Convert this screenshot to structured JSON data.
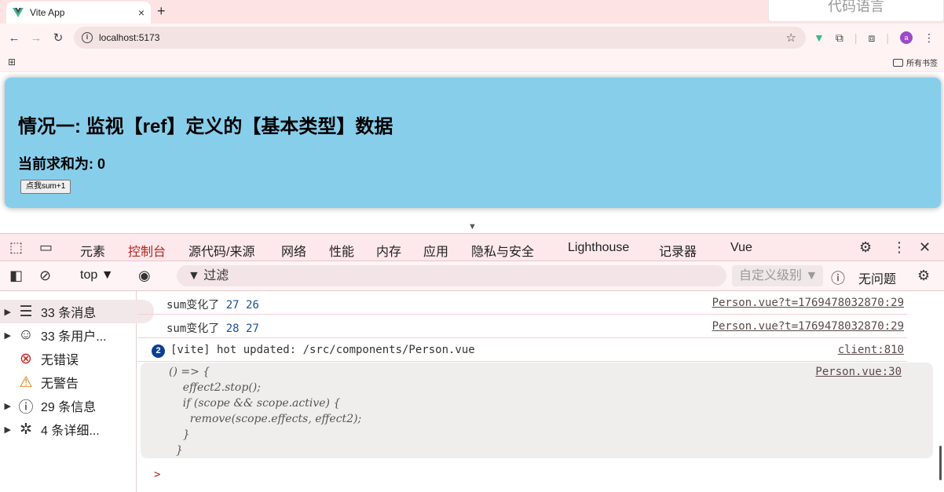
{
  "browser": {
    "tab_title": "Vite App",
    "tab_close": "×",
    "new_tab": "+",
    "overlay_text": "代码语言",
    "url": "localhost:5173",
    "bookmarks_all": "所有书签",
    "avatar_letter": "a"
  },
  "page": {
    "heading": "情况一: 监视【ref】定义的【基本类型】数据",
    "sum_text": "当前求和为: 0",
    "button_label": "点我sum+1"
  },
  "devtools": {
    "tabs": [
      "元素",
      "控制台",
      "源代码/来源",
      "网络",
      "性能",
      "内存",
      "应用",
      "隐私与安全",
      "Lighthouse",
      "记录器",
      "Vue"
    ],
    "active_tab": "控制台",
    "context": "top ▼",
    "filter_placeholder": "过滤",
    "levels": "自定义级别 ▼",
    "issues": "无问题",
    "sidebar": [
      {
        "label": "33 条消息",
        "icon": "list-icon",
        "expandable": true
      },
      {
        "label": "33 条用户...",
        "icon": "user-icon",
        "expandable": true
      },
      {
        "label": "无错误",
        "icon": "error-icon",
        "expandable": false
      },
      {
        "label": "无警告",
        "icon": "warning-icon",
        "expandable": false
      },
      {
        "label": "29 条信息",
        "icon": "info-icon",
        "expandable": true
      },
      {
        "label": "4 条详细...",
        "icon": "bug-icon",
        "expandable": true
      }
    ],
    "console_rows": [
      {
        "text": "sum变化了",
        "nums": "27 26",
        "source": "Person.vue?t=1769478032870:29"
      },
      {
        "text": "sum变化了",
        "nums": "28 27",
        "source": "Person.vue?t=1769478032870:29"
      },
      {
        "badge": "2",
        "text": "[vite] hot updated: /src/components/Person.vue",
        "source": "client:810"
      }
    ],
    "function_block": {
      "code": "() => {\n    effect2.stop();\n    if (scope && scope.active) {\n      remove(scope.effects, effect2);\n    }\n  }",
      "source": "Person.vue:30"
    },
    "prompt": ">"
  },
  "colors": {
    "card_bg": "#87ceeb",
    "tabstrip_bg": "#fde3e3",
    "devtools_accent": "#b3261e"
  }
}
